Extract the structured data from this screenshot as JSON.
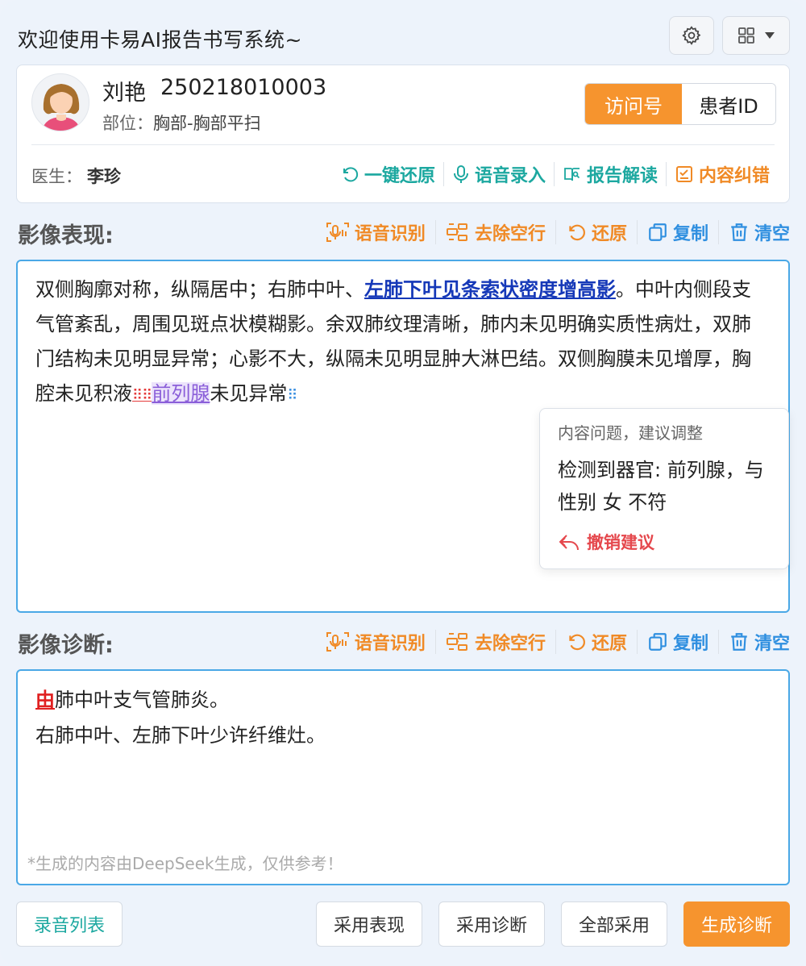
{
  "header": {
    "title": "欢迎使用卡易AI报告书写系统~",
    "settings_icon": "gear-icon",
    "layout_icon": "grid-icon"
  },
  "patient": {
    "name": "刘艳",
    "id": "250218010003",
    "part_label": "部位：",
    "part_value": "胸部-胸部平扫",
    "id_toggle": {
      "active": "访问号",
      "other": "患者ID"
    },
    "doctor_label": "医生：",
    "doctor_value": "李珍",
    "actions": {
      "restore_all": "一键还原",
      "voice_input": "语音录入",
      "report_read": "报告解读",
      "content_fix": "内容纠错"
    }
  },
  "findings": {
    "title": "影像表现:",
    "toolbar": {
      "asr": "语音识别",
      "remove_blank": "去除空行",
      "restore": "还原",
      "copy": "复制",
      "clear": "清空"
    },
    "text": {
      "part1": "双侧胸廓对称，纵隔居中；右肺中叶、",
      "highlight": "左肺下叶见条索状密度增高影",
      "part2": "。中叶内侧段支气管紊乱，周围见斑点状模糊影。余双肺纹理清晰，肺内未见明确实质性病灶，双肺门结构未见明显异常；心影不大，纵隔未见明显肿大淋巴结。双侧胸膜未见增厚，胸腔未见积液",
      "flagged": "前列腺",
      "part3": "未见异常"
    }
  },
  "popover": {
    "title": "内容问题，建议调整",
    "body": "检测到器官: 前列腺，与性别 女 不符",
    "undo": "撤销建议"
  },
  "diagnosis": {
    "title": "影像诊断:",
    "toolbar": {
      "asr": "语音识别",
      "remove_blank": "去除空行",
      "restore": "还原",
      "copy": "复制",
      "clear": "清空"
    },
    "line1_flag": "由",
    "line1_rest": "肺中叶支气管肺炎。",
    "line2": "右肺中叶、左肺下叶少许纤维灶。",
    "footnote": "*生成的内容由DeepSeek生成，仅供参考！"
  },
  "footer": {
    "record_list": "录音列表",
    "adopt_findings": "采用表现",
    "adopt_diagnosis": "采用诊断",
    "adopt_all": "全部采用",
    "generate": "生成诊断"
  },
  "colors": {
    "accent_orange": "#f6942e",
    "teal": "#1ca8a0",
    "editor_border": "#4aa8e6",
    "warn_red": "#e5484d"
  }
}
